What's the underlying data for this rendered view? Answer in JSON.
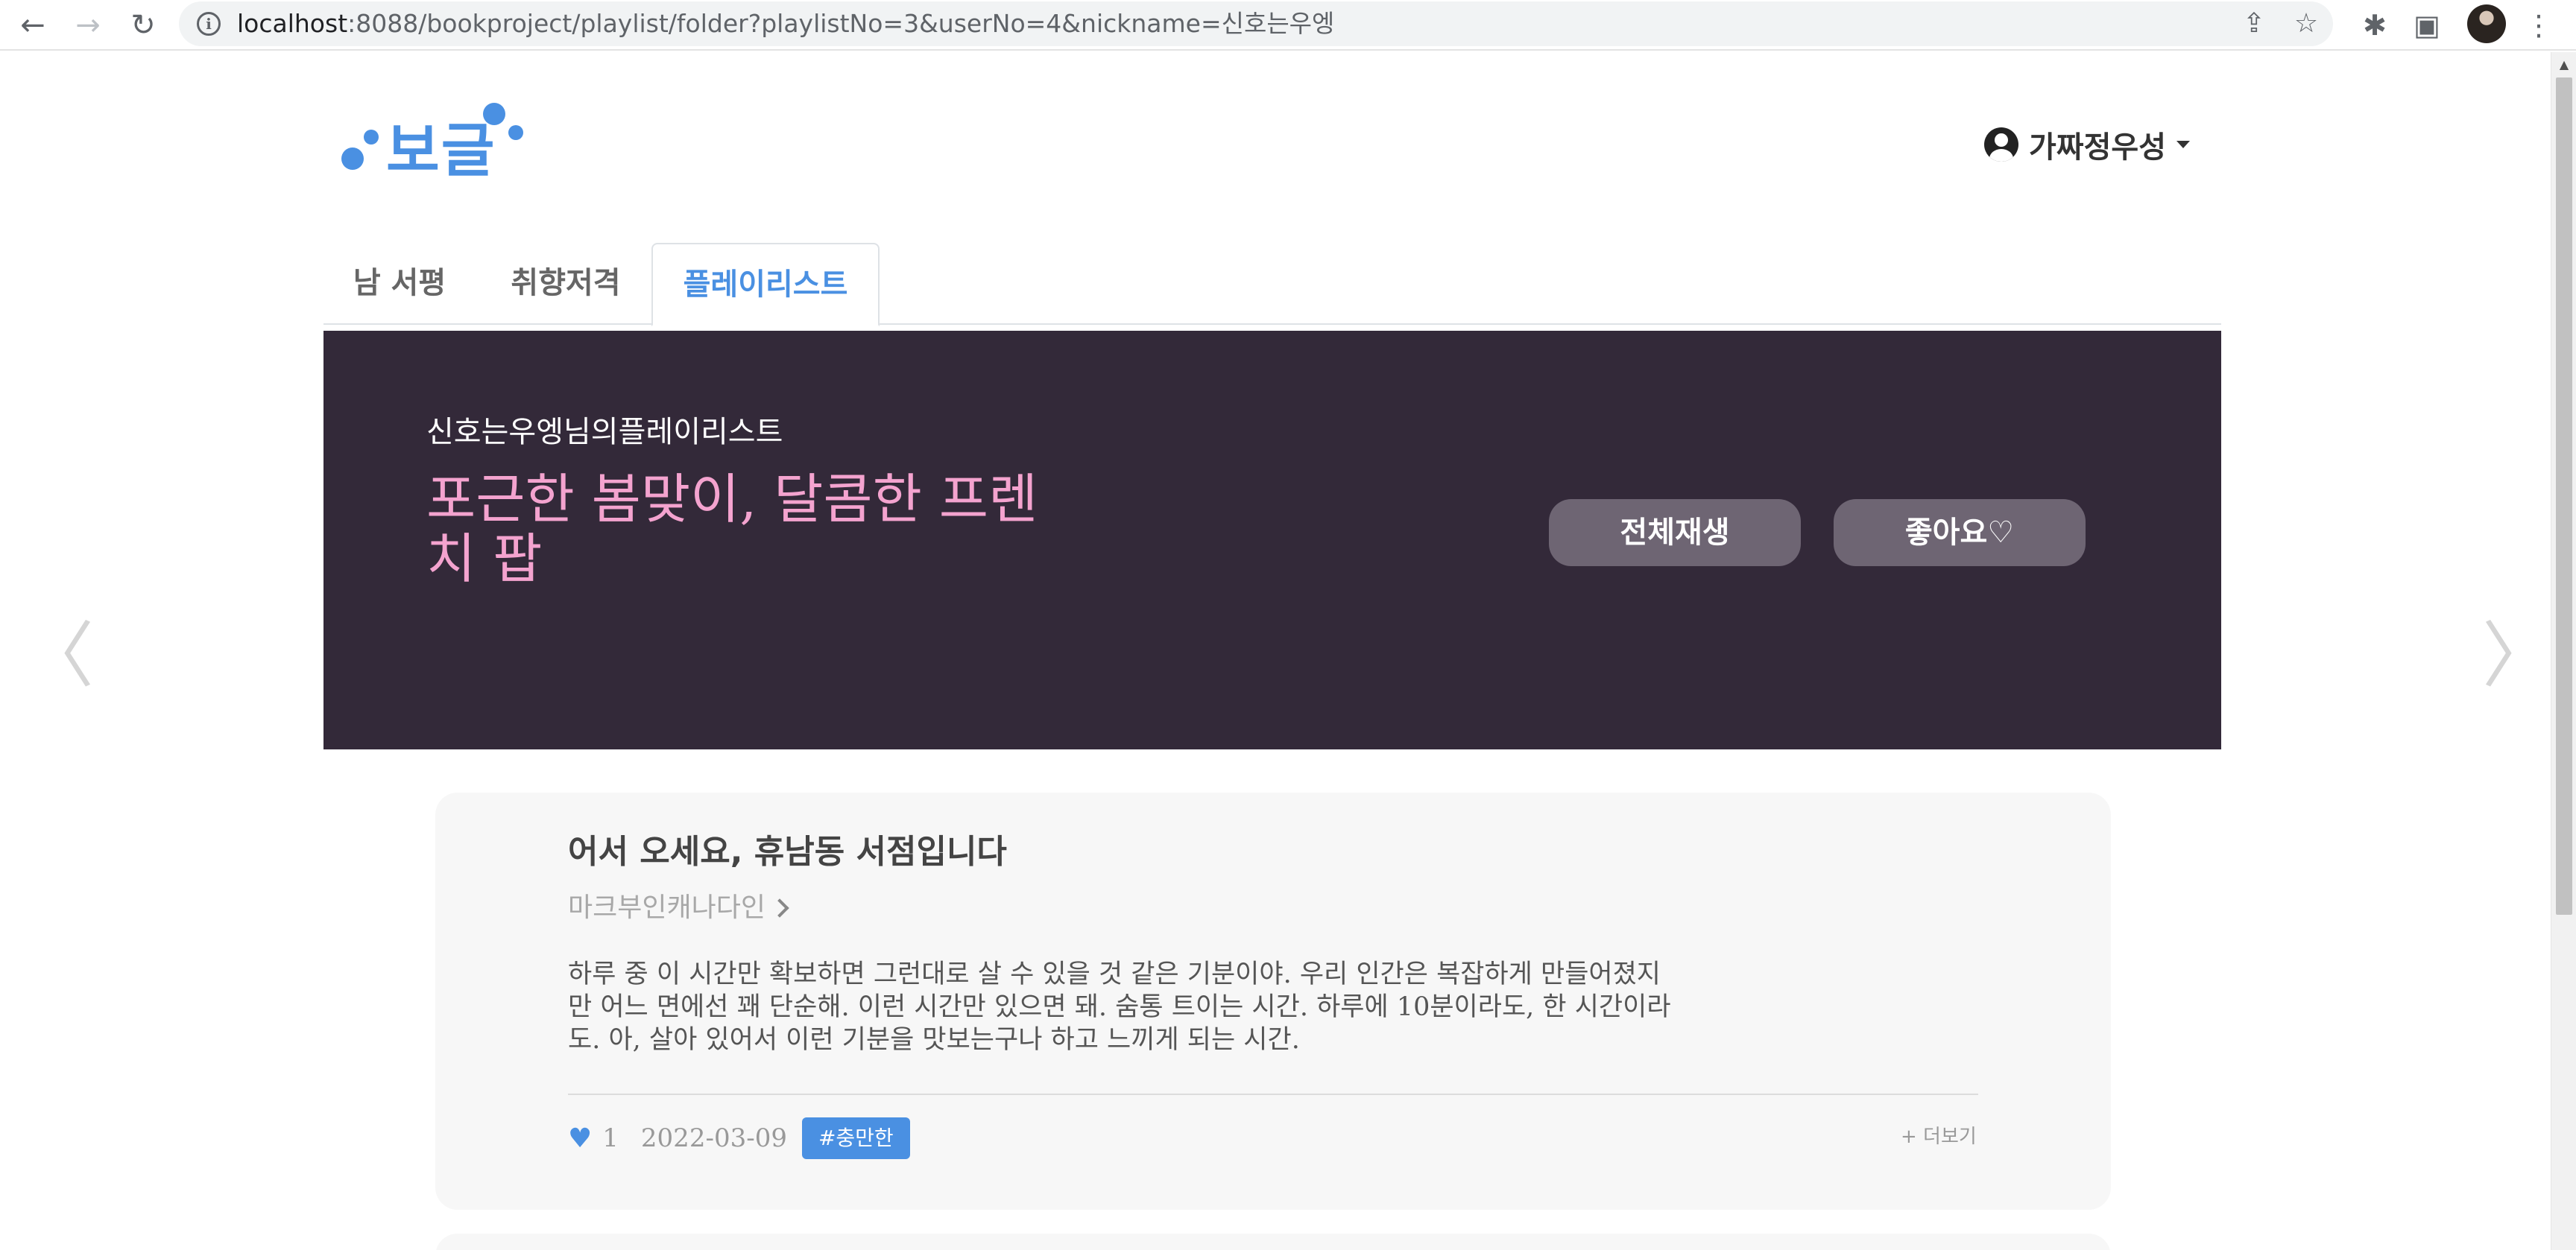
{
  "browser": {
    "url_host": "localhost",
    "url_rest": ":8088/bookproject/playlist/folder?playlistNo=3&userNo=4&nickname=신호는우엥"
  },
  "header": {
    "logo": "보글",
    "user": {
      "name": "가짜정우성"
    }
  },
  "tabs": [
    {
      "label": "남 서평"
    },
    {
      "label": "취향저격"
    },
    {
      "label": "플레이리스트",
      "active": true
    }
  ],
  "banner": {
    "subtitle": "신호는우엥님의플레이리스트",
    "title": "포근한 봄맞이, 달콤한 프렌치 팝",
    "play_all": "전체재생",
    "like": "좋아요♡"
  },
  "card": {
    "title": "어서 오세요, 휴남동 서점입니다",
    "author": "마크부인캐나다인",
    "review": "하루 중 이 시간만 확보하면 그런대로 살 수 있을 것 같은 기분이야. 우리 인간은 복잡하게 만들어졌지만 어느 면에선 꽤 단순해. 이런 시간만 있으면 돼. 숨통 트이는 시간. 하루에 10분이라도, 한 시간이라도. 아, 살아 있어서 이런 기분을 맛보는구나 하고 느끼게 되는 시간.",
    "likes": "1",
    "date": "2022-03-09",
    "tag": "#충만한",
    "more": "+ 더보기"
  },
  "colors": {
    "accent": "#4a90e2",
    "banner_bg": "#332939",
    "banner_title": "#f4a3cf",
    "card_bg": "#f7f7f7"
  }
}
